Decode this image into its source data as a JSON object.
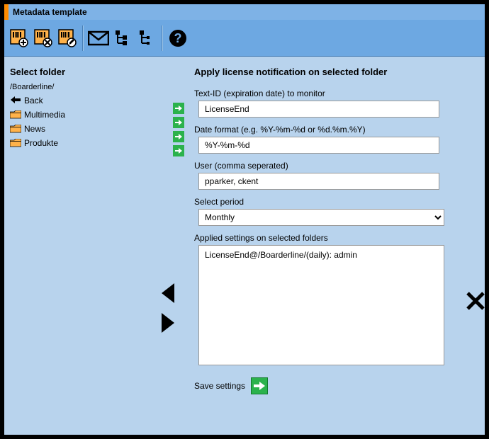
{
  "window": {
    "title": "Metadata template"
  },
  "sidebar": {
    "heading": "Select folder",
    "path": "/Boarderline/",
    "back_label": "Back",
    "items": [
      {
        "label": "Multimedia"
      },
      {
        "label": "News"
      },
      {
        "label": "Produkte"
      }
    ]
  },
  "main": {
    "heading": "Apply license notification on selected folder",
    "text_id_label": "Text-ID (expiration date) to monitor",
    "text_id_value": "LicenseEnd",
    "date_format_label": "Date format (e.g. %Y-%m-%d or %d.%m.%Y)",
    "date_format_value": "%Y-%m-%d",
    "user_label": "User (comma seperated)",
    "user_value": "pparker, ckent",
    "period_label": "Select period",
    "period_value": "Monthly",
    "applied_label": "Applied settings on selected folders",
    "applied_value": "LicenseEnd@/Boarderline/(daily): admin",
    "save_label": "Save settings"
  }
}
